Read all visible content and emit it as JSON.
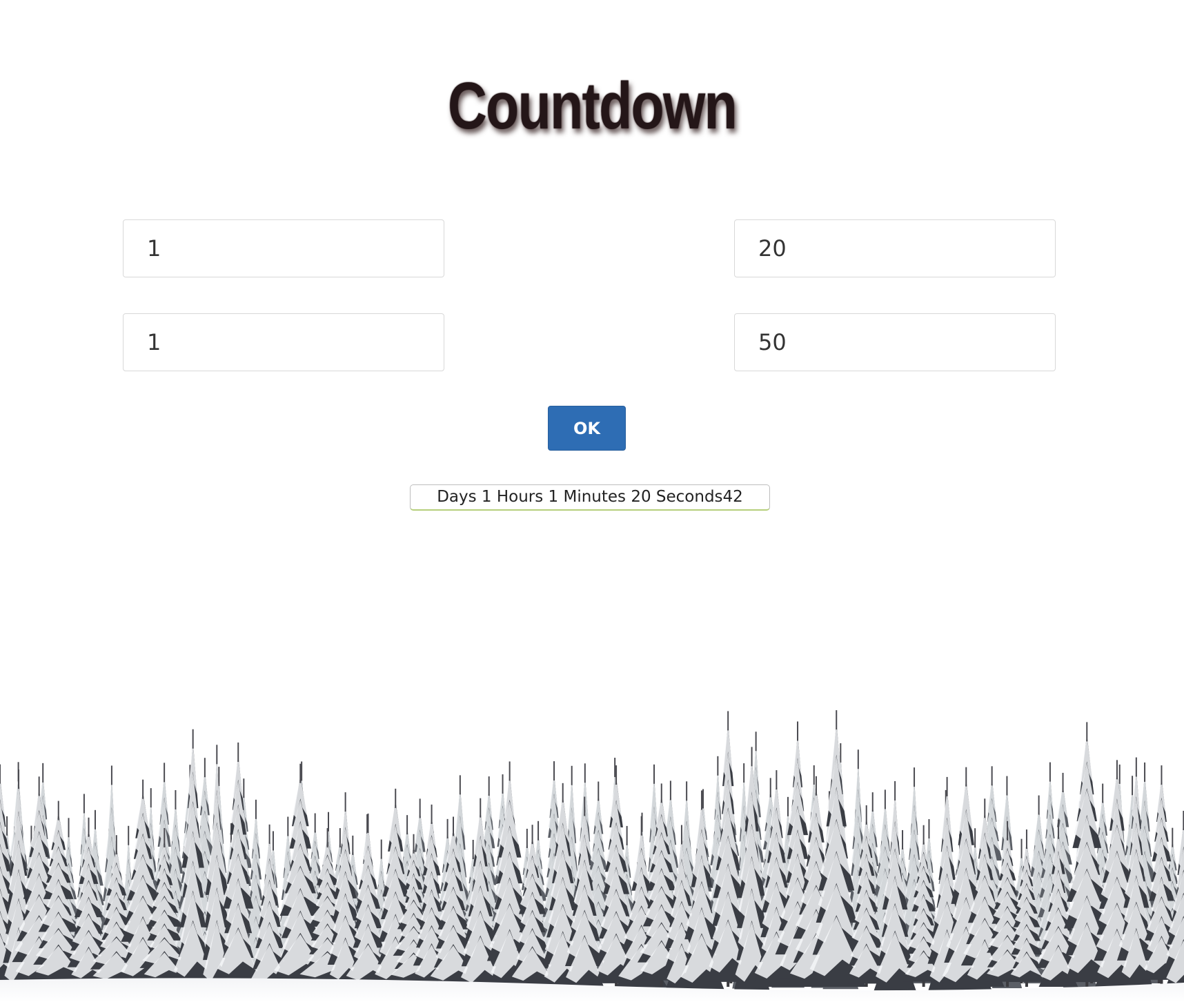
{
  "header": {
    "title": "Countdown"
  },
  "form": {
    "days_value": "1",
    "minutes_value": "20",
    "hours_value": "1",
    "seconds_value": "50",
    "ok_label": "OK"
  },
  "countdown": {
    "display_text": "Days 1 Hours 1 Minutes 20 Seconds42"
  },
  "colors": {
    "accent": "#2e6db4",
    "title": "#241618",
    "display_underline": "#b5cf7a"
  },
  "background": {
    "image_icon": "snowy-pine-forest"
  }
}
